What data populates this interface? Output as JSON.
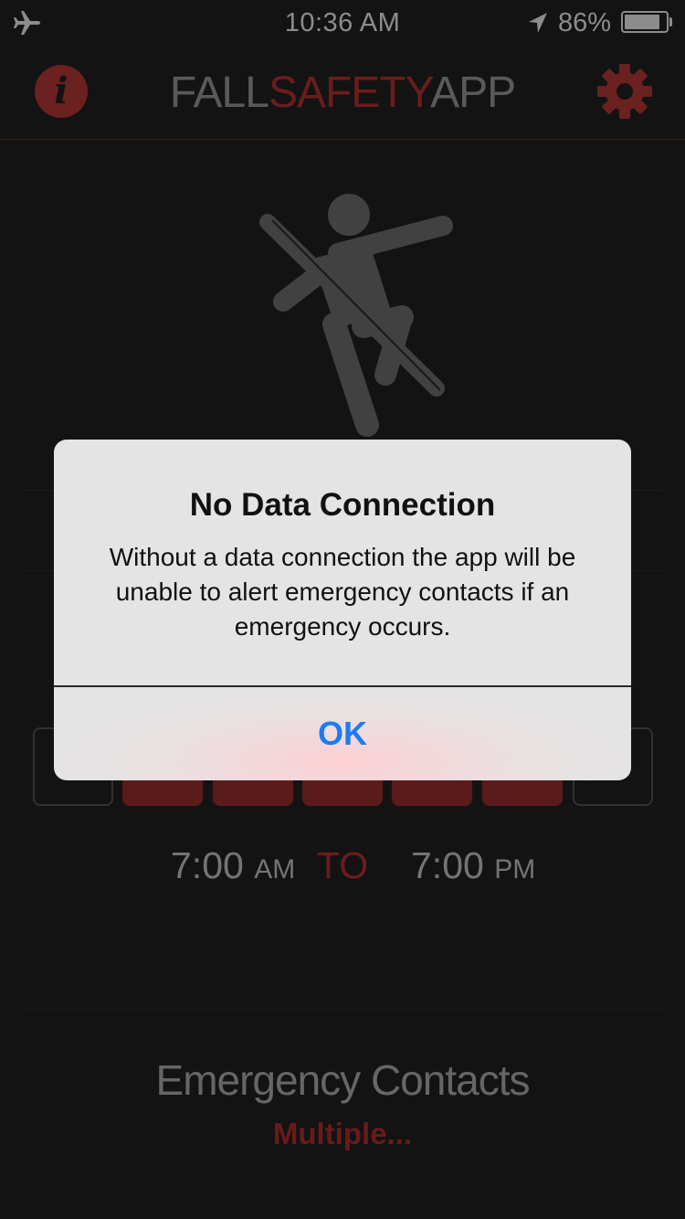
{
  "status_bar": {
    "time": "10:36 AM",
    "battery_percent": "86%",
    "battery_level": 0.86,
    "icons": [
      "airplane-icon",
      "location-arrow-icon",
      "battery-icon"
    ]
  },
  "header": {
    "title_part1": "FALL",
    "title_part2": "SAFETY",
    "title_part3": "APP",
    "info_label": "i"
  },
  "schedule": {
    "days": [
      {
        "active": false
      },
      {
        "active": true
      },
      {
        "active": true
      },
      {
        "active": true
      },
      {
        "active": true
      },
      {
        "active": true
      },
      {
        "active": false
      }
    ],
    "start_time": "7:00",
    "start_period": "AM",
    "separator": "TO",
    "end_time": "7:00",
    "end_period": "PM"
  },
  "emergency_contacts": {
    "label": "Emergency Contacts",
    "value": "Multiple..."
  },
  "alert": {
    "title": "No Data Connection",
    "message": "Without a data connection the app will be unable to alert emergency contacts if an emergency occurs.",
    "button": "OK"
  },
  "colors": {
    "accent_red": "#b8322f",
    "background": "#222222",
    "alert_button_blue": "#1a7cf5"
  }
}
